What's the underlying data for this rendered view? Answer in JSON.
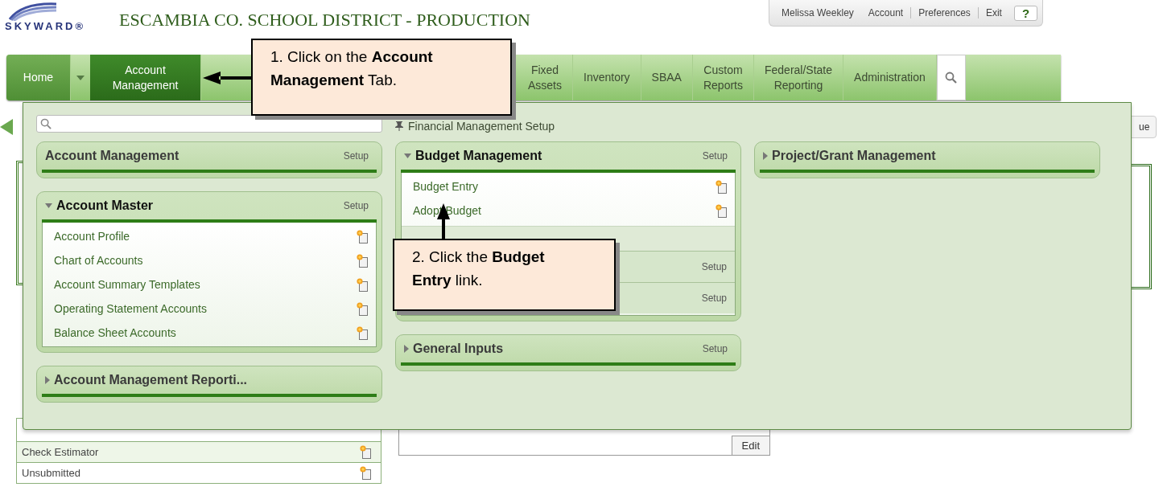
{
  "header": {
    "logo": "SKYWARD®",
    "title": "ESCAMBIA CO. SCHOOL DISTRICT - PRODUCTION"
  },
  "user_menu": {
    "name": "Melissa Weekley",
    "links": [
      "Account",
      "Preferences",
      "Exit"
    ],
    "help": "?"
  },
  "nav": {
    "tabs": [
      {
        "label": "Home",
        "selected": false
      },
      {
        "label": "Account\nManagement",
        "selected": true
      },
      {
        "label": "Fixed\nAssets",
        "selected": false
      },
      {
        "label": "Inventory",
        "selected": false
      },
      {
        "label": "SBAA",
        "selected": false
      },
      {
        "label": "Custom\nReports",
        "selected": false
      },
      {
        "label": "Federal/State\nReporting",
        "selected": false
      },
      {
        "label": "Administration",
        "selected": false
      }
    ]
  },
  "menu": {
    "breadcrumb": "Financial Management Setup",
    "columns": [
      [
        {
          "title": "Account Management",
          "kind": "plain",
          "expanded": false,
          "setup": "Setup"
        },
        {
          "title": "Account Master",
          "kind": "collapsible",
          "expanded": true,
          "setup": "Setup",
          "items": [
            {
              "kind": "link",
              "label": "Account Profile"
            },
            {
              "kind": "link",
              "label": "Chart of Accounts"
            },
            {
              "kind": "link",
              "label": "Account Summary Templates"
            },
            {
              "kind": "link",
              "label": "Operating Statement Accounts"
            },
            {
              "kind": "link",
              "label": "Balance Sheet Accounts"
            }
          ]
        },
        {
          "title": "Account Management Reporti...",
          "kind": "collapsible",
          "expanded": false
        }
      ],
      [
        {
          "title": "Budget Management",
          "kind": "collapsible",
          "expanded": true,
          "setup": "Setup",
          "items": [
            {
              "kind": "link",
              "label": "Budget Entry"
            },
            {
              "kind": "link",
              "label": "Adopt Budget"
            },
            {
              "kind": "subheader"
            },
            {
              "kind": "setup-row",
              "setup": "Setup"
            },
            {
              "kind": "setup-row",
              "setup": "Setup"
            }
          ]
        },
        {
          "title": "General Inputs",
          "kind": "collapsible",
          "expanded": false,
          "setup": "Setup"
        }
      ],
      [
        {
          "title": "Project/Grant Management",
          "kind": "collapsible",
          "expanded": false
        }
      ]
    ]
  },
  "background": {
    "list": [
      "Check Estimator",
      "Unsubmitted"
    ],
    "edit_button": "Edit",
    "side_button": "ue"
  },
  "callouts": [
    {
      "text": "1. Click on the **Account Management** Tab."
    },
    {
      "text": "2. Click the **Budget Entry** link."
    }
  ]
}
